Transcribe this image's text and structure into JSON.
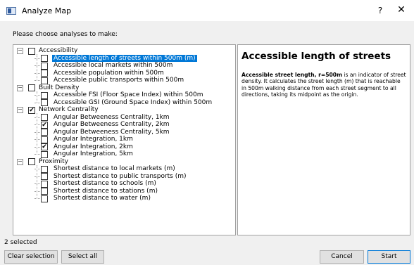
{
  "window": {
    "title": "Analyze Map",
    "help": "?",
    "close": "✕"
  },
  "prompt": "Please choose analyses to make:",
  "tree": [
    {
      "label": "Accessibility",
      "checked": false,
      "items": [
        {
          "label": "Accessible length of streets within 500m (m)",
          "checked": false,
          "selected": true
        },
        {
          "label": "Accessible local markets within 500m",
          "checked": false
        },
        {
          "label": "Accessible population within 500m",
          "checked": false
        },
        {
          "label": "Accessible public transports within 500m",
          "checked": false
        }
      ]
    },
    {
      "label": "Built Density",
      "checked": false,
      "items": [
        {
          "label": "Accessible FSI (Floor Space Index) within 500m",
          "checked": false
        },
        {
          "label": "Accessible GSI (Ground Space Index) within 500m",
          "checked": false
        }
      ]
    },
    {
      "label": "Network Centrality",
      "checked": true,
      "items": [
        {
          "label": "Angular Betweeness Centrality, 1km",
          "checked": false
        },
        {
          "label": "Angular Betweeness Centrality, 2km",
          "checked": true
        },
        {
          "label": "Angular Betweeness Centrality, 5km",
          "checked": false
        },
        {
          "label": "Angular Integration, 1km",
          "checked": false
        },
        {
          "label": "Angular Integration, 2km",
          "checked": true
        },
        {
          "label": "Angular Integration, 5km",
          "checked": false
        }
      ]
    },
    {
      "label": "Proximity",
      "checked": false,
      "items": [
        {
          "label": "Shortest distance to local markets (m)",
          "checked": false
        },
        {
          "label": "Shortest distance to public transports (m)",
          "checked": false
        },
        {
          "label": "Shortest distance to schools (m)",
          "checked": false
        },
        {
          "label": "Shortest distance to stations (m)",
          "checked": false
        },
        {
          "label": "Shortest distance to water (m)",
          "checked": false
        }
      ]
    }
  ],
  "description": {
    "title": "Accessible length of streets",
    "bold": "Accessible street length, r=500m",
    "text": " is an indicator of street density. It calculates the street length (m) that is reachable in 500m walking distance from each street segment to all directions, taking its midpoint as the origin."
  },
  "footer": {
    "count": "2 selected",
    "clear": "Clear selection",
    "select_all": "Select all",
    "cancel": "Cancel",
    "start": "Start"
  },
  "colors": {
    "selection": "#0078d7",
    "background": "#f0f0f0"
  }
}
